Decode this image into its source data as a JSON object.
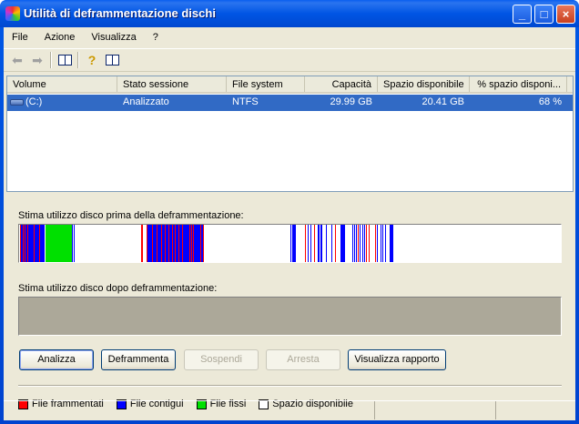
{
  "window": {
    "title": "Utilità di deframmentazione dischi"
  },
  "menu": [
    "File",
    "Azione",
    "Visualizza",
    "?"
  ],
  "list": {
    "columns": [
      "Volume",
      "Stato sessione",
      "File system",
      "Capacità",
      "Spazio disponibile",
      "% spazio disponi..."
    ],
    "rows": [
      {
        "volume": "(C:)",
        "status": "Analizzato",
        "fs": "NTFS",
        "capacity": "29.99 GB",
        "free": "20.41 GB",
        "pct": "68 %"
      }
    ]
  },
  "before_label": "Stima utilizzo disco prima della deframmentazione:",
  "after_label": "Stima utilizzo disco dopo deframmentazione:",
  "disk_map_before": [
    {
      "from": 0.002,
      "to": 0.047,
      "type": "mixed"
    },
    {
      "from": 0.049,
      "to": 0.097,
      "type": "fixed"
    },
    {
      "from": 0.097,
      "to": 0.104,
      "type": "contiguous-sparse"
    },
    {
      "from": 0.225,
      "to": 0.228,
      "type": "fragmented"
    },
    {
      "from": 0.236,
      "to": 0.342,
      "type": "mixed"
    },
    {
      "from": 0.501,
      "to": 0.6,
      "type": "mixed-sparse"
    },
    {
      "from": 0.615,
      "to": 0.69,
      "type": "mixed-sparse"
    }
  ],
  "buttons": {
    "analyze": "Analizza",
    "defrag": "Deframmenta",
    "pause": "Sospendi",
    "stop": "Arresta",
    "report": "Visualizza rapporto"
  },
  "legend": [
    {
      "label": "File frammentati",
      "color": "#ff0000"
    },
    {
      "label": "File contigui",
      "color": "#0000ff"
    },
    {
      "label": "File fissi",
      "color": "#00e000"
    },
    {
      "label": "Spazio disponibile",
      "color": "#ffffff"
    }
  ]
}
